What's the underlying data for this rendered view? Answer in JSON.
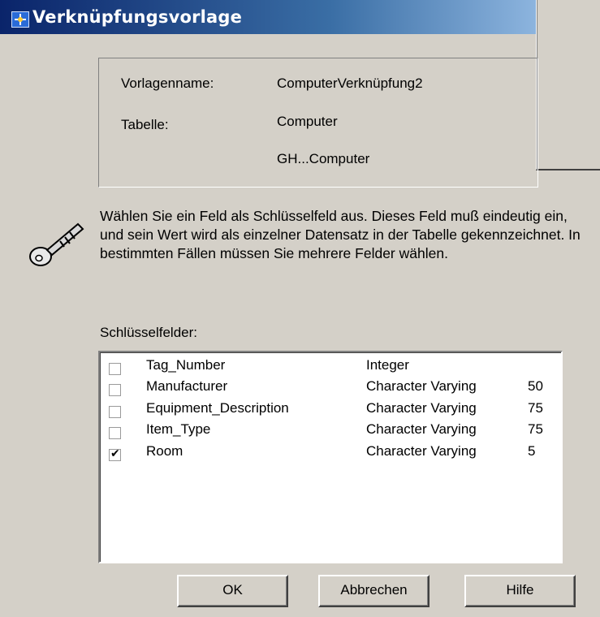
{
  "window": {
    "title": "Verknüpfungsvorlage"
  },
  "info": {
    "template_label": "Vorlagenname:",
    "template_value": "ComputerVerknüpfung2",
    "table_label": "Tabelle:",
    "table_value": "Computer",
    "table_source": "GH...Computer"
  },
  "description": "Wählen Sie ein Feld als Schlüsselfeld aus. Dieses Feld muß eindeutig ein, und sein Wert wird als einzelner Datensatz in der Tabelle gekennzeichnet. In bestimmten Fällen müssen Sie mehrere Felder wählen.",
  "keyfields": {
    "label": "Schlüsselfelder:",
    "rows": [
      {
        "name": "Tag_Number",
        "type": "Integer",
        "size": "",
        "checked": false
      },
      {
        "name": "Manufacturer",
        "type": "Character Varying",
        "size": "50",
        "checked": false
      },
      {
        "name": "Equipment_Description",
        "type": "Character Varying",
        "size": "75",
        "checked": false
      },
      {
        "name": "Item_Type",
        "type": "Character Varying",
        "size": "75",
        "checked": false
      },
      {
        "name": "Room",
        "type": "Character Varying",
        "size": "5",
        "checked": true
      }
    ]
  },
  "buttons": {
    "ok": "OK",
    "cancel": "Abbrechen",
    "help": "Hilfe"
  },
  "icons": {
    "title": "app-link-icon",
    "key": "key-icon"
  },
  "colors": {
    "dialog_bg": "#d4d0c8",
    "titlebar_start": "#0a246a",
    "titlebar_end": "#a6caf0"
  }
}
